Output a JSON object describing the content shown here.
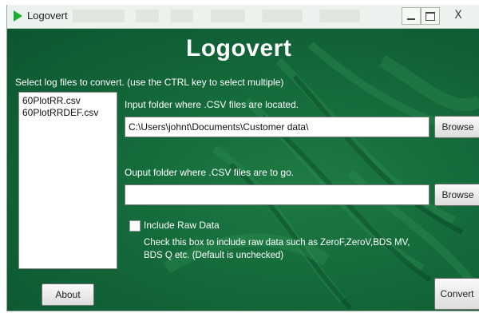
{
  "window": {
    "title": "Logovert",
    "close_glyph": "X"
  },
  "app": {
    "title": "Logovert"
  },
  "instruction": "Select log files to convert. (use the CTRL key to select multiple)",
  "file_list": [
    "60PlotRR.csv",
    "60PlotRRDEF.csv"
  ],
  "input_folder": {
    "label": "Input folder where .CSV files are located.",
    "value": "C:\\Users\\johnt\\Documents\\Customer data\\",
    "browse_label": "Browse"
  },
  "output_folder": {
    "label": "Ouput folder where .CSV files are to go.",
    "value": "",
    "browse_label": "Browse"
  },
  "include_raw": {
    "label": "Include Raw Data",
    "checked": false,
    "help": "Check this box to include raw data such as ZeroF,ZeroV,BDS MV, BDS Q etc. (Default is unchecked)"
  },
  "buttons": {
    "about": "About",
    "convert": "Convert"
  },
  "colors": {
    "background": "#0e5a2f",
    "accent": "#19b135"
  },
  "icons": [
    "app-play-icon",
    "minimize-icon",
    "maximize-icon",
    "close-icon"
  ]
}
